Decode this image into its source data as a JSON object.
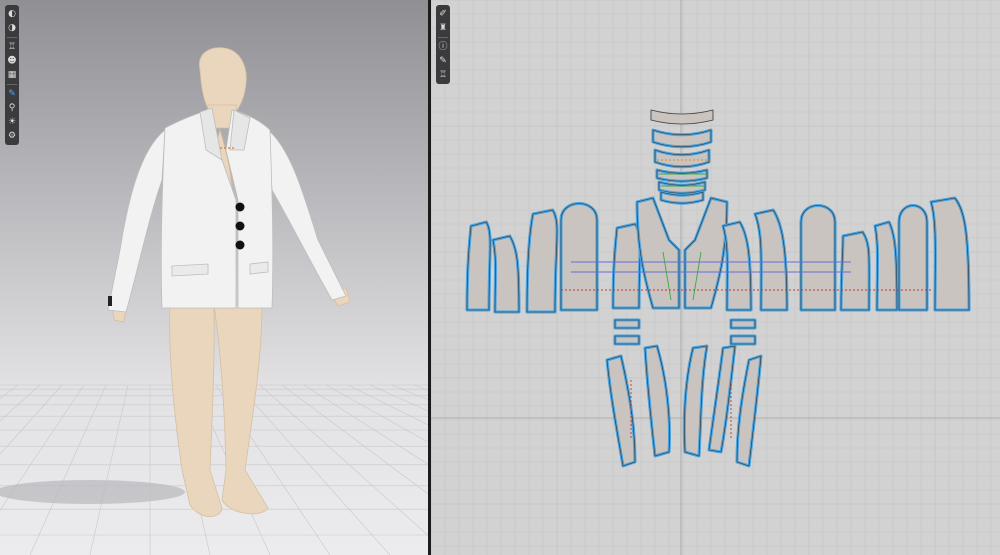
{
  "colors": {
    "seam_blue": "#4aa3df",
    "piece_fill": "#c9c4bf",
    "internal_red": "#c0392b",
    "internal_orange": "#e08a2b",
    "internal_green": "#3aa845",
    "garment_white": "#f2f2f2",
    "avatar_skin": "#e9d6bd",
    "button_black": "#111111"
  },
  "viewport3d": {
    "toolbar": [
      "view-mode-icon",
      "display-mode-icon",
      "garment-icon",
      "avatar-icon",
      "fabric-icon",
      "select-mesh-icon",
      "pin-icon",
      "steam-icon",
      "settings-icon"
    ],
    "active_tool": "select-mesh-icon",
    "garment": "jacket-3d-model"
  },
  "viewport2d": {
    "toolbar": [
      "pattern-edit-icon",
      "garment-pattern-icon",
      "info-icon",
      "pen-icon",
      "shirt-view-icon"
    ],
    "pattern_piece_count": 32
  }
}
